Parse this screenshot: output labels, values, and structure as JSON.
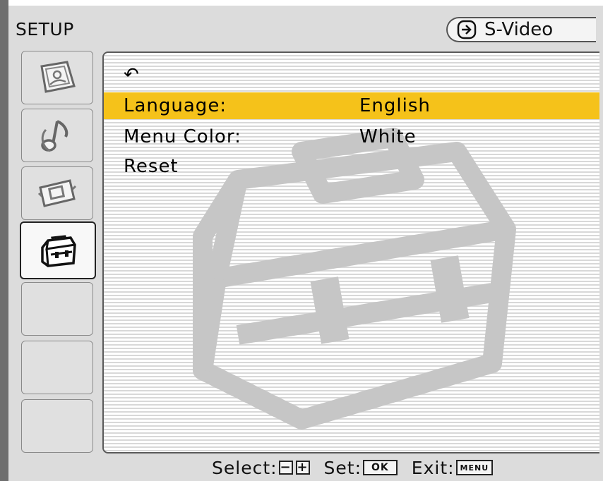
{
  "header": {
    "title": "SETUP",
    "input_source": "S-Video",
    "input_icon": "input-arrow-icon"
  },
  "sidebar": {
    "tabs": [
      {
        "icon": "photo-icon",
        "active": false
      },
      {
        "icon": "music-icon",
        "active": false
      },
      {
        "icon": "video-icon",
        "active": false
      },
      {
        "icon": "toolbox-icon",
        "active": true
      },
      {
        "icon": "",
        "active": false
      },
      {
        "icon": "",
        "active": false
      },
      {
        "icon": "",
        "active": false
      }
    ]
  },
  "menu": {
    "back_glyph": "↶",
    "items": [
      {
        "label": "Language:",
        "value": "English",
        "selected": true
      },
      {
        "label": "Menu Color:",
        "value": "White",
        "selected": false
      },
      {
        "label": "Reset",
        "value": "",
        "selected": false
      }
    ]
  },
  "footer": {
    "select_label": "Select:",
    "minus_key": "−",
    "plus_key": "+",
    "set_label": "Set:",
    "ok_key": "OK",
    "exit_label": "Exit:",
    "menu_key": "MENU"
  },
  "colors": {
    "highlight": "#f5c21a",
    "background": "#dcdcdc"
  }
}
